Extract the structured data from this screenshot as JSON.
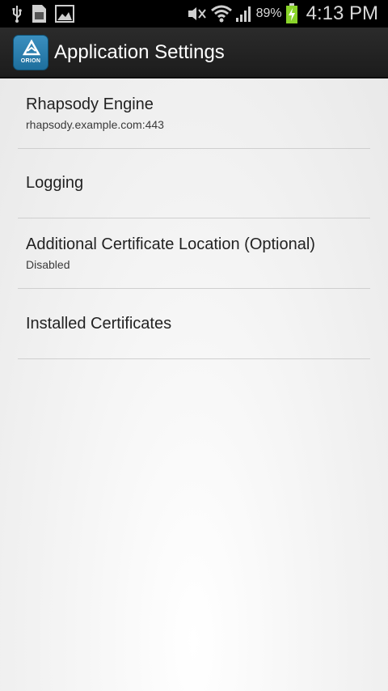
{
  "status_bar": {
    "left_icons": [
      "usb-icon",
      "sim-card-icon",
      "gallery-icon"
    ],
    "right_icons": [
      "mute-icon",
      "wifi-icon",
      "signal-icon",
      "battery-icon"
    ],
    "battery_percent": "89%",
    "time": "4:13 PM"
  },
  "action_bar": {
    "app_icon_text": "ORION",
    "title": "Application Settings"
  },
  "preferences": [
    {
      "title": "Rhapsody Engine",
      "summary": "rhapsody.example.com:443"
    },
    {
      "title": "Logging",
      "summary": ""
    },
    {
      "title": "Additional Certificate Location (Optional)",
      "summary": "Disabled"
    },
    {
      "title": "Installed Certificates",
      "summary": ""
    }
  ],
  "colors": {
    "action_bar": "#222222",
    "app_icon": "#2a82b3",
    "battery_charging": "#8ad42a"
  }
}
